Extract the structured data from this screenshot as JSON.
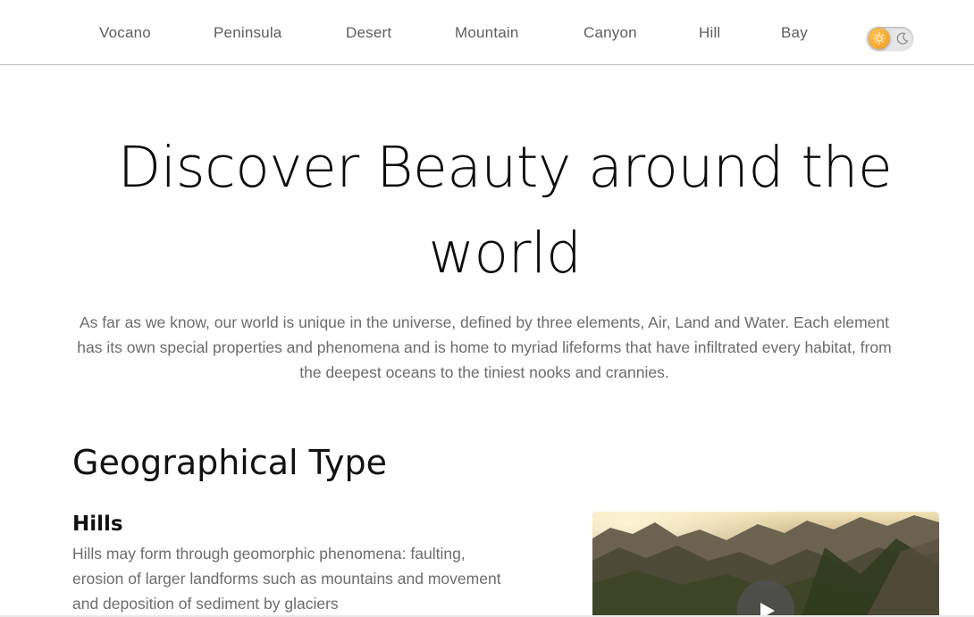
{
  "nav": {
    "items": [
      {
        "label": "Vocano"
      },
      {
        "label": "Peninsula"
      },
      {
        "label": "Desert"
      },
      {
        "label": "Mountain"
      },
      {
        "label": "Canyon"
      },
      {
        "label": "Hill"
      },
      {
        "label": "Bay"
      }
    ],
    "theme_toggle": {
      "state": "light",
      "knob_icon": "sun-icon",
      "off_icon": "moon-icon",
      "accent": "#f0961c"
    }
  },
  "hero": {
    "title": "Discover Beauty around the world",
    "description": "As far as we know, our world is unique in the universe, defined by three elements, Air, Land and Water. Each element has its own special properties and phenomena and is home to myriad lifeforms that have infiltrated every habitat, from the deepest oceans to the tiniest nooks and crannies."
  },
  "section": {
    "title": "Geographical Type",
    "card": {
      "title": "Hills",
      "description": "Hills may form through geomorphic phenomena: faulting, erosion of larger landforms such as mountains and movement and deposition of sediment by glaciers",
      "media_icon": "play-icon"
    }
  }
}
